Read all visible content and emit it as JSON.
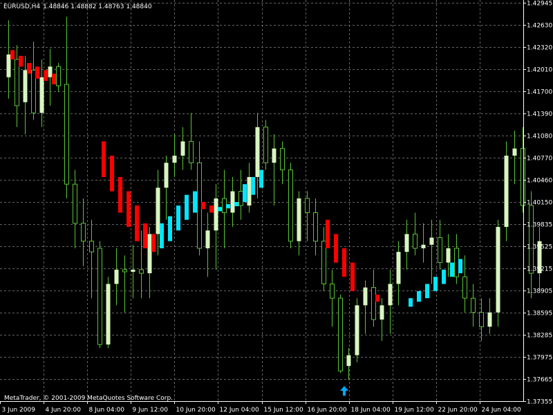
{
  "header": {
    "symbol": "EURUSD,H4",
    "quote": "1.48846 1.48882 1.48763 1.48840"
  },
  "footer": {
    "copyright": "MetaTrader, © 2001-2009 MetaQuotes Software Corp."
  },
  "colors": {
    "background": "#000000",
    "grid": "#666666",
    "axis": "#ffffff",
    "candle_bull": "#d8f5c0",
    "candle_bear": "#000000",
    "wick": "#5ac832",
    "bar_down": "#ff0000",
    "bar_up": "#00e6ff",
    "arrow": "#00aaff"
  },
  "icons": {
    "buy_arrow": "arrow-up-icon"
  },
  "chart_data": {
    "type": "candlestick",
    "y_ticks": [
      "1.42945",
      "1.42630",
      "1.42320",
      "1.42010",
      "1.41700",
      "1.41390",
      "1.41080",
      "1.40770",
      "1.40460",
      "1.40150",
      "1.39835",
      "1.39525",
      "1.39215",
      "1.38905",
      "1.38595",
      "1.38285",
      "1.37975",
      "1.37665",
      "1.37355"
    ],
    "x_ticks": [
      "3 Jun 2009",
      "4 Jun 20:00",
      "8 Jun 04:00",
      "9 Jun 12:00",
      "10 Jun 20:00",
      "12 Jun 04:00",
      "15 Jun 12:00",
      "16 Jun 20:00",
      "18 Jun 04:00",
      "19 Jun 12:00",
      "22 Jun 20:00",
      "24 Jun 04:00"
    ],
    "ylim": [
      1.37355,
      1.42945
    ],
    "candles": [
      {
        "o": 1.419,
        "h": 1.427,
        "l": 1.416,
        "c": 1.4222
      },
      {
        "o": 1.4215,
        "h": 1.4235,
        "l": 1.412,
        "c": 1.415
      },
      {
        "o": 1.4155,
        "h": 1.422,
        "l": 1.411,
        "c": 1.42
      },
      {
        "o": 1.42,
        "h": 1.424,
        "l": 1.413,
        "c": 1.414
      },
      {
        "o": 1.414,
        "h": 1.4215,
        "l": 1.412,
        "c": 1.419
      },
      {
        "o": 1.419,
        "h": 1.423,
        "l": 1.415,
        "c": 1.4205
      },
      {
        "o": 1.4205,
        "h": 1.421,
        "l": 1.417,
        "c": 1.4178
      },
      {
        "o": 1.418,
        "h": 1.4275,
        "l": 1.402,
        "c": 1.404
      },
      {
        "o": 1.404,
        "h": 1.406,
        "l": 1.395,
        "c": 1.3985
      },
      {
        "o": 1.3985,
        "h": 1.402,
        "l": 1.3925,
        "c": 1.396
      },
      {
        "o": 1.396,
        "h": 1.399,
        "l": 1.388,
        "c": 1.3945
      },
      {
        "o": 1.395,
        "h": 1.396,
        "l": 1.381,
        "c": 1.3815
      },
      {
        "o": 1.3815,
        "h": 1.391,
        "l": 1.381,
        "c": 1.39
      },
      {
        "o": 1.39,
        "h": 1.395,
        "l": 1.387,
        "c": 1.392
      },
      {
        "o": 1.392,
        "h": 1.394,
        "l": 1.386,
        "c": 1.3917
      },
      {
        "o": 1.3917,
        "h": 1.3955,
        "l": 1.388,
        "c": 1.392
      },
      {
        "o": 1.392,
        "h": 1.3975,
        "l": 1.388,
        "c": 1.3915
      },
      {
        "o": 1.3915,
        "h": 1.398,
        "l": 1.388,
        "c": 1.397
      },
      {
        "o": 1.397,
        "h": 1.406,
        "l": 1.394,
        "c": 1.4035
      },
      {
        "o": 1.4035,
        "h": 1.408,
        "l": 1.399,
        "c": 1.407
      },
      {
        "o": 1.407,
        "h": 1.411,
        "l": 1.405,
        "c": 1.408
      },
      {
        "o": 1.408,
        "h": 1.412,
        "l": 1.406,
        "c": 1.41
      },
      {
        "o": 1.41,
        "h": 1.414,
        "l": 1.406,
        "c": 1.407
      },
      {
        "o": 1.407,
        "h": 1.41,
        "l": 1.394,
        "c": 1.395
      },
      {
        "o": 1.395,
        "h": 1.4,
        "l": 1.391,
        "c": 1.3975
      },
      {
        "o": 1.3975,
        "h": 1.404,
        "l": 1.392,
        "c": 1.402
      },
      {
        "o": 1.402,
        "h": 1.406,
        "l": 1.395,
        "c": 1.4
      },
      {
        "o": 1.4,
        "h": 1.405,
        "l": 1.398,
        "c": 1.403
      },
      {
        "o": 1.403,
        "h": 1.406,
        "l": 1.399,
        "c": 1.401
      },
      {
        "o": 1.401,
        "h": 1.407,
        "l": 1.4,
        "c": 1.405
      },
      {
        "o": 1.405,
        "h": 1.414,
        "l": 1.402,
        "c": 1.412
      },
      {
        "o": 1.412,
        "h": 1.413,
        "l": 1.406,
        "c": 1.407
      },
      {
        "o": 1.407,
        "h": 1.411,
        "l": 1.401,
        "c": 1.409
      },
      {
        "o": 1.409,
        "h": 1.41,
        "l": 1.404,
        "c": 1.406
      },
      {
        "o": 1.406,
        "h": 1.407,
        "l": 1.395,
        "c": 1.396
      },
      {
        "o": 1.396,
        "h": 1.403,
        "l": 1.394,
        "c": 1.402
      },
      {
        "o": 1.402,
        "h": 1.403,
        "l": 1.396,
        "c": 1.4
      },
      {
        "o": 1.4,
        "h": 1.402,
        "l": 1.394,
        "c": 1.396
      },
      {
        "o": 1.396,
        "h": 1.398,
        "l": 1.389,
        "c": 1.39
      },
      {
        "o": 1.39,
        "h": 1.392,
        "l": 1.384,
        "c": 1.388
      },
      {
        "o": 1.388,
        "h": 1.3885,
        "l": 1.3775,
        "c": 1.3778
      },
      {
        "o": 1.3785,
        "h": 1.381,
        "l": 1.3765,
        "c": 1.38
      },
      {
        "o": 1.38,
        "h": 1.388,
        "l": 1.379,
        "c": 1.387
      },
      {
        "o": 1.387,
        "h": 1.3905,
        "l": 1.383,
        "c": 1.3895
      },
      {
        "o": 1.3895,
        "h": 1.392,
        "l": 1.384,
        "c": 1.385
      },
      {
        "o": 1.385,
        "h": 1.388,
        "l": 1.382,
        "c": 1.387
      },
      {
        "o": 1.387,
        "h": 1.392,
        "l": 1.383,
        "c": 1.39
      },
      {
        "o": 1.39,
        "h": 1.396,
        "l": 1.387,
        "c": 1.3945
      },
      {
        "o": 1.3945,
        "h": 1.399,
        "l": 1.392,
        "c": 1.397
      },
      {
        "o": 1.397,
        "h": 1.4,
        "l": 1.394,
        "c": 1.395
      },
      {
        "o": 1.395,
        "h": 1.3985,
        "l": 1.393,
        "c": 1.3955
      },
      {
        "o": 1.3955,
        "h": 1.399,
        "l": 1.39,
        "c": 1.3965
      },
      {
        "o": 1.3965,
        "h": 1.399,
        "l": 1.392,
        "c": 1.393
      },
      {
        "o": 1.393,
        "h": 1.397,
        "l": 1.391,
        "c": 1.395
      },
      {
        "o": 1.395,
        "h": 1.397,
        "l": 1.39,
        "c": 1.391
      },
      {
        "o": 1.391,
        "h": 1.394,
        "l": 1.386,
        "c": 1.388
      },
      {
        "o": 1.388,
        "h": 1.39,
        "l": 1.384,
        "c": 1.386
      },
      {
        "o": 1.386,
        "h": 1.388,
        "l": 1.382,
        "c": 1.384
      },
      {
        "o": 1.384,
        "h": 1.388,
        "l": 1.383,
        "c": 1.386
      },
      {
        "o": 1.386,
        "h": 1.399,
        "l": 1.384,
        "c": 1.398
      },
      {
        "o": 1.398,
        "h": 1.41,
        "l": 1.396,
        "c": 1.408
      },
      {
        "o": 1.408,
        "h": 1.4115,
        "l": 1.404,
        "c": 1.409
      },
      {
        "o": 1.409,
        "h": 1.412,
        "l": 1.4,
        "c": 1.401
      },
      {
        "o": 1.401,
        "h": 1.403,
        "l": 1.388,
        "c": 1.3915
      },
      {
        "o": 1.3915,
        "h": 1.398,
        "l": 1.389,
        "c": 1.396
      }
    ],
    "signal_bars": [
      {
        "i": 0,
        "dir": "down",
        "top": 1.4228,
        "bottom": 1.4215
      },
      {
        "i": 1,
        "dir": "down",
        "top": 1.422,
        "bottom": 1.4205
      },
      {
        "i": 2,
        "dir": "down",
        "top": 1.421,
        "bottom": 1.4195
      },
      {
        "i": 3,
        "dir": "down",
        "top": 1.4205,
        "bottom": 1.4188
      },
      {
        "i": 4,
        "dir": "down",
        "top": 1.42,
        "bottom": 1.4185
      },
      {
        "i": 5,
        "dir": "down",
        "top": 1.4195,
        "bottom": 1.418
      },
      {
        "i": 11,
        "dir": "down",
        "top": 1.41,
        "bottom": 1.405
      },
      {
        "i": 12,
        "dir": "down",
        "top": 1.408,
        "bottom": 1.403
      },
      {
        "i": 13,
        "dir": "down",
        "top": 1.405,
        "bottom": 1.4
      },
      {
        "i": 14,
        "dir": "down",
        "top": 1.403,
        "bottom": 1.398
      },
      {
        "i": 15,
        "dir": "down",
        "top": 1.401,
        "bottom": 1.396
      },
      {
        "i": 16,
        "dir": "down",
        "top": 1.3985,
        "bottom": 1.395
      },
      {
        "i": 17,
        "dir": "down",
        "top": 1.397,
        "bottom": 1.3945
      },
      {
        "i": 18,
        "dir": "up",
        "top": 1.3985,
        "bottom": 1.395
      },
      {
        "i": 19,
        "dir": "up",
        "top": 1.3995,
        "bottom": 1.396
      },
      {
        "i": 20,
        "dir": "up",
        "top": 1.401,
        "bottom": 1.3975
      },
      {
        "i": 21,
        "dir": "up",
        "top": 1.4025,
        "bottom": 1.399
      },
      {
        "i": 22,
        "dir": "up",
        "top": 1.403,
        "bottom": 1.4
      },
      {
        "i": 23,
        "dir": "down",
        "top": 1.4015,
        "bottom": 1.4005
      },
      {
        "i": 24,
        "dir": "down",
        "top": 1.401,
        "bottom": 1.4
      },
      {
        "i": 25,
        "dir": "up",
        "top": 1.4008,
        "bottom": 1.4002
      },
      {
        "i": 26,
        "dir": "up",
        "top": 1.4012,
        "bottom": 1.4006
      },
      {
        "i": 27,
        "dir": "up",
        "top": 1.4015,
        "bottom": 1.4009
      },
      {
        "i": 28,
        "dir": "up",
        "top": 1.404,
        "bottom": 1.4015
      },
      {
        "i": 29,
        "dir": "up",
        "top": 1.405,
        "bottom": 1.4025
      },
      {
        "i": 30,
        "dir": "up",
        "top": 1.406,
        "bottom": 1.4035
      },
      {
        "i": 38,
        "dir": "down",
        "top": 1.399,
        "bottom": 1.395
      },
      {
        "i": 39,
        "dir": "down",
        "top": 1.397,
        "bottom": 1.393
      },
      {
        "i": 40,
        "dir": "down",
        "top": 1.395,
        "bottom": 1.391
      },
      {
        "i": 41,
        "dir": "down",
        "top": 1.393,
        "bottom": 1.389
      },
      {
        "i": 44,
        "dir": "down",
        "top": 1.3885,
        "bottom": 1.3875
      },
      {
        "i": 48,
        "dir": "up",
        "top": 1.388,
        "bottom": 1.3868
      },
      {
        "i": 49,
        "dir": "up",
        "top": 1.389,
        "bottom": 1.3875
      },
      {
        "i": 50,
        "dir": "up",
        "top": 1.39,
        "bottom": 1.388
      },
      {
        "i": 51,
        "dir": "up",
        "top": 1.391,
        "bottom": 1.389
      },
      {
        "i": 52,
        "dir": "up",
        "top": 1.392,
        "bottom": 1.39
      },
      {
        "i": 53,
        "dir": "up",
        "top": 1.393,
        "bottom": 1.391
      },
      {
        "i": 54,
        "dir": "up",
        "top": 1.3935,
        "bottom": 1.3915
      }
    ],
    "buy_arrow": {
      "i": 40,
      "value": 1.375
    }
  }
}
